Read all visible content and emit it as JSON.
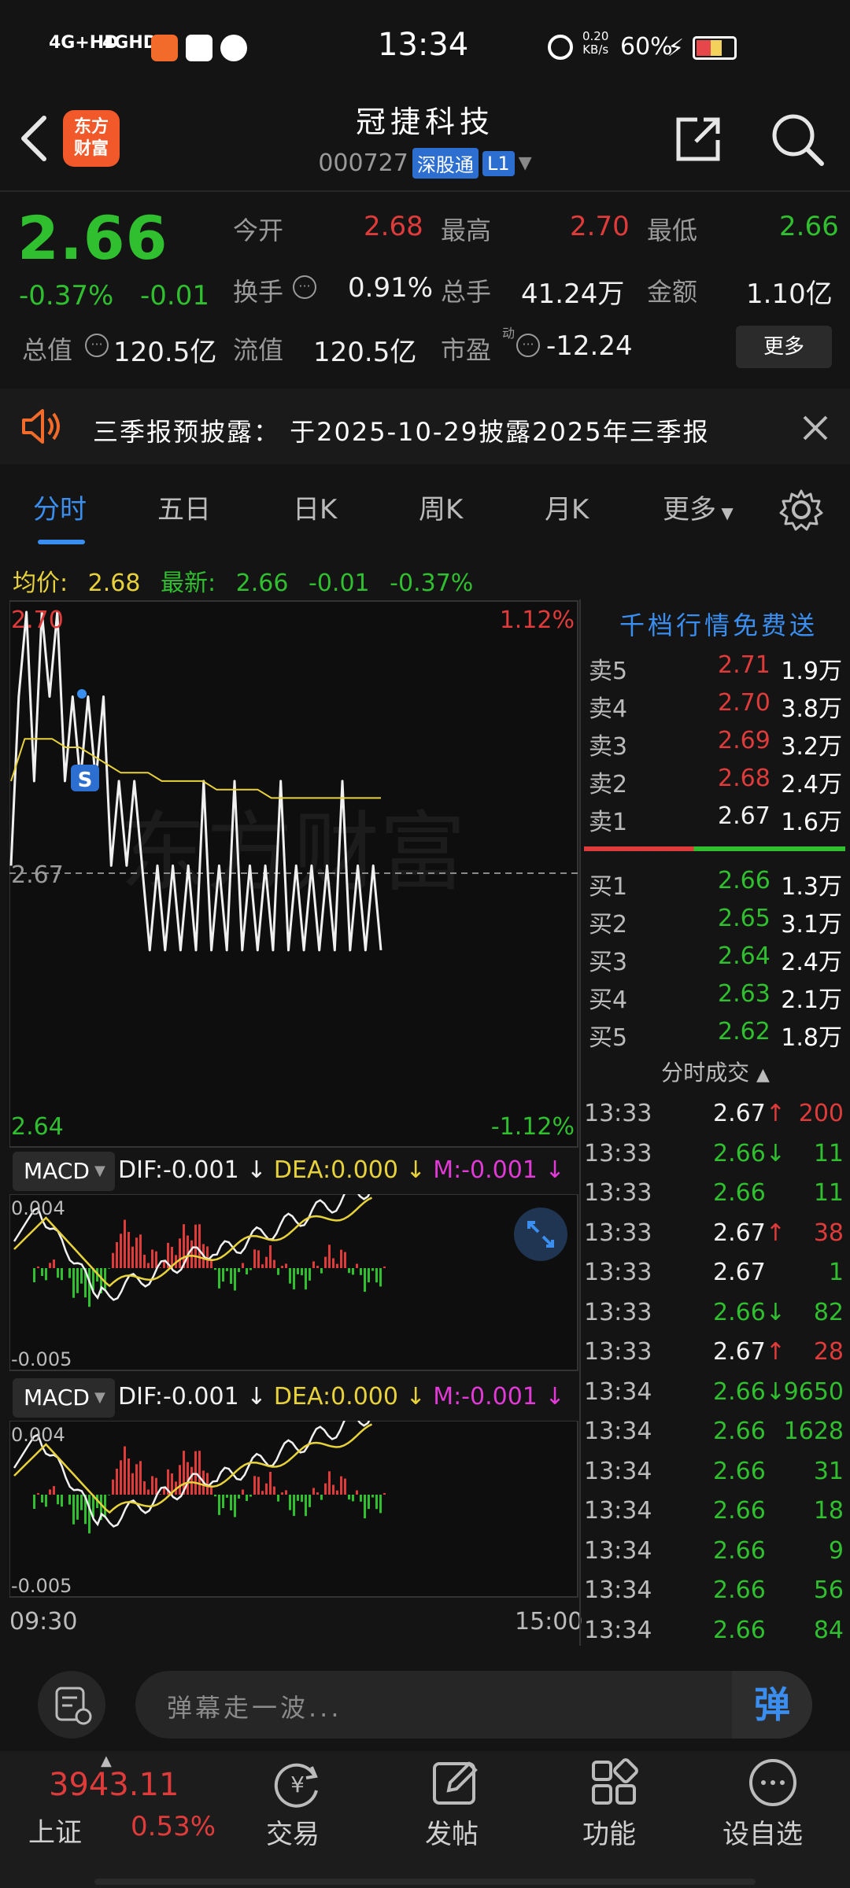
{
  "status_bar": {
    "network1": "4G+HD",
    "network2": "4GHD",
    "time": "13:34",
    "speed_value": "0.20",
    "speed_unit": "KB/s",
    "battery": "60%"
  },
  "header": {
    "logo_line1": "东方",
    "logo_line2": "财富",
    "stock_name": "冠捷科技",
    "stock_code": "000727",
    "tag_connect": "深股通",
    "tag_level": "L1"
  },
  "quote": {
    "price": "2.66",
    "change_pct": "-0.37%",
    "change": "-0.01",
    "open_label": "今开",
    "open": "2.68",
    "high_label": "最高",
    "high": "2.70",
    "low_label": "最低",
    "low": "2.66",
    "turnover_label": "换手",
    "turnover": "0.91%",
    "volume_label": "总手",
    "volume": "41.24万",
    "amount_label": "金额",
    "amount": "1.10亿",
    "mktcap_label": "总值",
    "mktcap": "120.5亿",
    "float_label": "流值",
    "float": "120.5亿",
    "pe_label": "市盈",
    "pe_sup": "动",
    "pe": "-12.24",
    "more_label": "更多"
  },
  "notice": {
    "text": "三季报预披露：  于2025-10-29披露2025年三季报"
  },
  "tabs": [
    "分时",
    "五日",
    "日K",
    "周K",
    "月K",
    "更多"
  ],
  "info_line": {
    "avg_label": "均价:",
    "avg": "2.68",
    "latest_label": "最新:",
    "latest": "2.66",
    "chg": "-0.01",
    "chg_pct": "-0.37%"
  },
  "chart_data": {
    "type": "line",
    "y_top": "2.70",
    "y_mid": "2.67",
    "y_bottom": "2.64",
    "pct_top": "1.12%",
    "pct_bottom": "-1.12%",
    "x_start": "09:30",
    "x_end": "15:00",
    "watermark": "东方财富",
    "marker": "S",
    "series": [
      {
        "name": "price",
        "values": [
          2.67,
          2.69,
          2.7,
          2.68,
          2.7,
          2.69,
          2.7,
          2.68,
          2.69,
          2.68,
          2.69,
          2.68,
          2.69,
          2.67,
          2.68,
          2.67,
          2.68,
          2.67,
          2.66,
          2.67,
          2.66,
          2.67,
          2.66,
          2.67,
          2.66,
          2.68,
          2.66,
          2.67,
          2.66,
          2.68,
          2.66,
          2.67,
          2.66,
          2.67,
          2.66,
          2.68,
          2.66,
          2.67,
          2.66,
          2.67,
          2.66,
          2.67,
          2.66,
          2.68,
          2.66,
          2.67,
          2.66,
          2.67,
          2.66
        ]
      },
      {
        "name": "avg",
        "values": [
          2.68,
          2.685,
          2.685,
          2.685,
          2.684,
          2.684,
          2.683,
          2.682,
          2.681,
          2.681,
          2.681,
          2.68,
          2.68,
          2.68,
          2.68,
          2.679,
          2.679,
          2.679,
          2.679,
          2.678,
          2.678,
          2.678,
          2.678,
          2.678,
          2.678,
          2.678,
          2.678,
          2.678
        ]
      }
    ]
  },
  "macd1": {
    "label": "MACD",
    "dif": "DIF:-0.001",
    "dea": "DEA:0.000",
    "m": "M:-0.001",
    "top": "0.004",
    "bottom": "-0.005"
  },
  "macd2": {
    "label": "MACD",
    "dif": "DIF:-0.001",
    "dea": "DEA:0.000",
    "m": "M:-0.001",
    "top": "0.004",
    "bottom": "-0.005"
  },
  "orderbook": {
    "title": "千档行情免费送",
    "asks": [
      {
        "label": "卖5",
        "price": "2.71",
        "vol": "1.9万"
      },
      {
        "label": "卖4",
        "price": "2.70",
        "vol": "3.8万"
      },
      {
        "label": "卖3",
        "price": "2.69",
        "vol": "3.2万"
      },
      {
        "label": "卖2",
        "price": "2.68",
        "vol": "2.4万"
      },
      {
        "label": "卖1",
        "price": "2.67",
        "vol": "1.6万"
      }
    ],
    "bids": [
      {
        "label": "买1",
        "price": "2.66",
        "vol": "1.3万"
      },
      {
        "label": "买2",
        "price": "2.65",
        "vol": "3.1万"
      },
      {
        "label": "买3",
        "price": "2.64",
        "vol": "2.4万"
      },
      {
        "label": "买4",
        "price": "2.63",
        "vol": "2.1万"
      },
      {
        "label": "买5",
        "price": "2.62",
        "vol": "1.8万"
      }
    ]
  },
  "ticks": {
    "title": "分时成交",
    "rows": [
      {
        "time": "13:33",
        "price": "2.67",
        "dir": "up",
        "vol": "200"
      },
      {
        "time": "13:33",
        "price": "2.66",
        "dir": "down",
        "vol": "11"
      },
      {
        "time": "13:33",
        "price": "2.66",
        "dir": "",
        "vol": "11"
      },
      {
        "time": "13:33",
        "price": "2.67",
        "dir": "up",
        "vol": "38"
      },
      {
        "time": "13:33",
        "price": "2.67",
        "dir": "",
        "vol": "1"
      },
      {
        "time": "13:33",
        "price": "2.66",
        "dir": "down",
        "vol": "82"
      },
      {
        "time": "13:33",
        "price": "2.67",
        "dir": "up",
        "vol": "28"
      },
      {
        "time": "13:34",
        "price": "2.66",
        "dir": "down",
        "vol": "9650"
      },
      {
        "time": "13:34",
        "price": "2.66",
        "dir": "",
        "vol": "1628"
      },
      {
        "time": "13:34",
        "price": "2.66",
        "dir": "",
        "vol": "31"
      },
      {
        "time": "13:34",
        "price": "2.66",
        "dir": "",
        "vol": "18"
      },
      {
        "time": "13:34",
        "price": "2.66",
        "dir": "",
        "vol": "9"
      },
      {
        "time": "13:34",
        "price": "2.66",
        "dir": "",
        "vol": "56"
      },
      {
        "time": "13:34",
        "price": "2.66",
        "dir": "",
        "vol": "84"
      }
    ]
  },
  "input": {
    "placeholder": "弹幕走一波...",
    "send": "弹"
  },
  "bottom_nav": {
    "index_value": "3943.11",
    "index_name": "上证",
    "index_pct": "0.53%",
    "items": [
      "交易",
      "发帖",
      "功能",
      "设自选"
    ]
  },
  "colors": {
    "up": "#e03b3b",
    "down": "#2fbf2f",
    "accent": "#3a8ef0",
    "avg_line": "#e8d23a",
    "brand": "#f1592a"
  }
}
